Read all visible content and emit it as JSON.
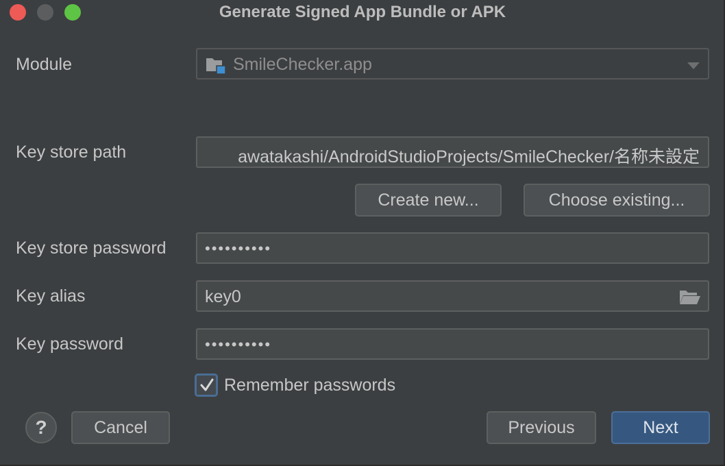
{
  "window": {
    "title": "Generate Signed App Bundle or APK"
  },
  "form": {
    "module_label": "Module",
    "module_value": "SmileChecker.app",
    "keystore_path_label": "Key store path",
    "keystore_path_value": "awatakashi/AndroidStudioProjects/SmileChecker/名称未設定",
    "create_new_label": "Create new...",
    "choose_existing_label": "Choose existing...",
    "keystore_password_label": "Key store password",
    "keystore_password_value": "••••••••••",
    "key_alias_label": "Key alias",
    "key_alias_value": "key0",
    "key_password_label": "Key password",
    "key_password_value": "••••••••••",
    "remember_passwords_label": "Remember passwords",
    "remember_passwords_checked": true
  },
  "footer": {
    "help_label": "?",
    "cancel_label": "Cancel",
    "previous_label": "Previous",
    "next_label": "Next"
  },
  "icons": {
    "module": "module-folder-icon",
    "dropdown": "chevron-down-icon",
    "folder": "folder-open-icon",
    "check": "checkmark-icon"
  },
  "colors": {
    "background": "#3c3f41",
    "primary_button": "#365880",
    "close": "#ee5a55",
    "zoom": "#5ec445"
  }
}
